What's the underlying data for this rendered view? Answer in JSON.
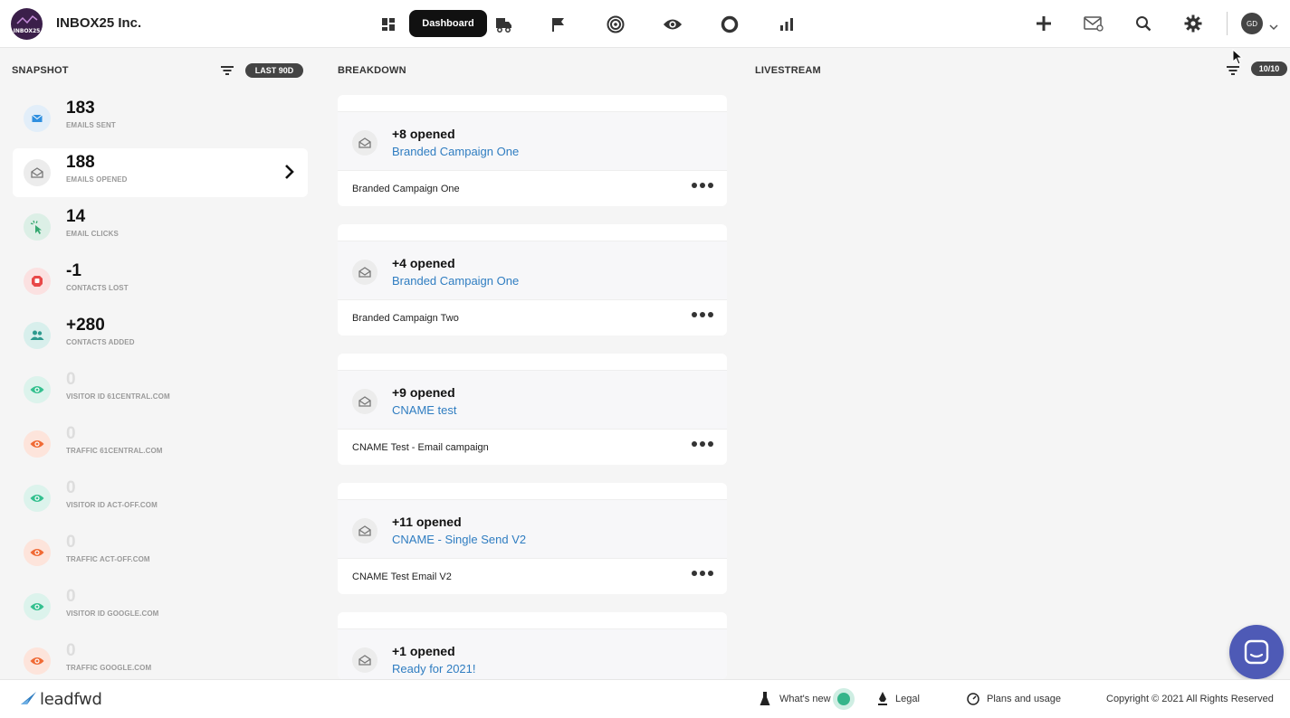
{
  "header": {
    "logo_text": "INBOX25",
    "company": "INBOX25 Inc.",
    "active_tab": "Dashboard",
    "nav_icons": [
      "grid-icon",
      "truck-icon",
      "flag-icon",
      "target-icon",
      "eye-icon",
      "circle-icon",
      "bar-chart-icon"
    ],
    "right_icons": [
      "plus-icon",
      "mail-icon",
      "search-icon",
      "gear-icon"
    ],
    "avatar_initials": "GD"
  },
  "snapshot": {
    "title": "SNAPSHOT",
    "range_badge": "LAST 90D",
    "items": [
      {
        "value": "183",
        "label": "EMAILS SENT",
        "icon": "envelope-icon",
        "circle_color": "#e2eef9",
        "icon_color": "#2f8fe0",
        "dim": false,
        "active": false
      },
      {
        "value": "188",
        "label": "EMAILS OPENED",
        "icon": "open-envelope-icon",
        "circle_color": "#ececec",
        "icon_color": "#777777",
        "dim": false,
        "active": true
      },
      {
        "value": "14",
        "label": "EMAIL CLICKS",
        "icon": "cursor-click-icon",
        "circle_color": "#dcefe6",
        "icon_color": "#35a870",
        "dim": false,
        "active": false
      },
      {
        "value": "-1",
        "label": "CONTACTS LOST",
        "icon": "stop-icon",
        "circle_color": "#fbe1e1",
        "icon_color": "#e84848",
        "dim": false,
        "active": false
      },
      {
        "value": "+280",
        "label": "CONTACTS ADDED",
        "icon": "users-icon",
        "circle_color": "#d8efec",
        "icon_color": "#2e9a8e",
        "dim": false,
        "active": false
      },
      {
        "value": "0",
        "label": "VISITOR ID 61CENTRAL.COM",
        "icon": "eye-icon",
        "circle_color": "#dcf3ec",
        "icon_color": "#34c08f",
        "dim": true,
        "active": false
      },
      {
        "value": "0",
        "label": "TRAFFIC 61CENTRAL.COM",
        "icon": "eye-icon",
        "circle_color": "#fde4db",
        "icon_color": "#f06a35",
        "dim": true,
        "active": false
      },
      {
        "value": "0",
        "label": "VISITOR ID ACT-OFF.COM",
        "icon": "eye-icon",
        "circle_color": "#dcf3ec",
        "icon_color": "#34c08f",
        "dim": true,
        "active": false
      },
      {
        "value": "0",
        "label": "TRAFFIC ACT-OFF.COM",
        "icon": "eye-icon",
        "circle_color": "#fde4db",
        "icon_color": "#f06a35",
        "dim": true,
        "active": false
      },
      {
        "value": "0",
        "label": "VISITOR ID GOOGLE.COM",
        "icon": "eye-icon",
        "circle_color": "#dcf3ec",
        "icon_color": "#34c08f",
        "dim": true,
        "active": false
      },
      {
        "value": "0",
        "label": "TRAFFIC GOOGLE.COM",
        "icon": "eye-icon",
        "circle_color": "#fde4db",
        "icon_color": "#f06a35",
        "dim": true,
        "active": false
      }
    ]
  },
  "breakdown": {
    "title": "BREAKDOWN",
    "cards": [
      {
        "title": "+8 opened",
        "link": "Branded Campaign One",
        "footer": "Branded Campaign One"
      },
      {
        "title": "+4 opened",
        "link": "Branded Campaign One",
        "footer": "Branded Campaign Two"
      },
      {
        "title": "+9 opened",
        "link": "CNAME test",
        "footer": "CNAME Test - Email campaign"
      },
      {
        "title": "+11 opened",
        "link": "CNAME - Single Send V2",
        "footer": "CNAME Test Email V2"
      },
      {
        "title": "+1 opened",
        "link": "Ready for 2021!",
        "footer": ""
      }
    ]
  },
  "livestream": {
    "title": "LIVESTREAM",
    "count_badge": "10/10"
  },
  "footer": {
    "brand": "leadfwd",
    "whats_new": "What's new",
    "legal": "Legal",
    "plans": "Plans and usage",
    "copyright": "Copyright © 2021 All Rights Reserved"
  }
}
